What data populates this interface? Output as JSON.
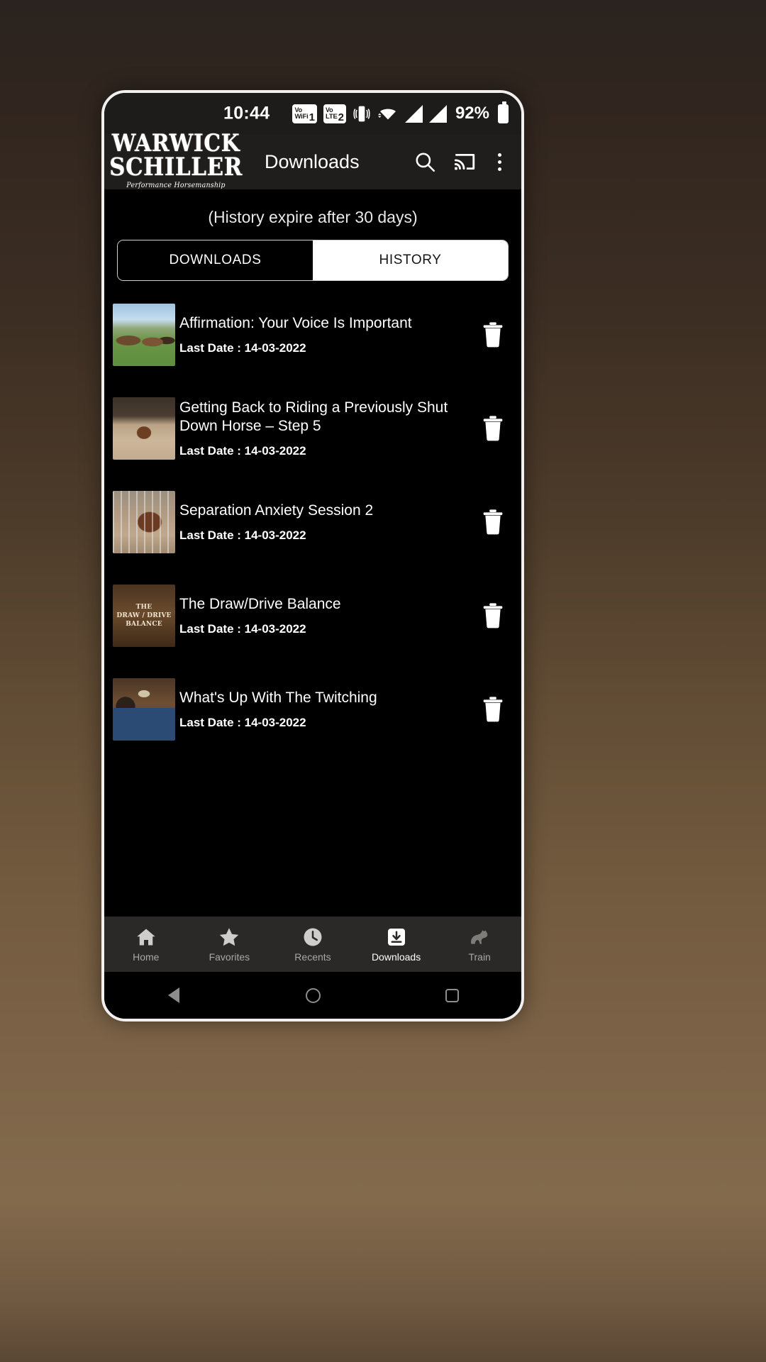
{
  "status_bar": {
    "time": "10:44",
    "battery_percent": "92%",
    "icons": [
      "vowifi-1-icon",
      "volte-2-icon",
      "vibrate-icon",
      "wifi-icon",
      "signal-bars-icon",
      "signal-bars-2-icon",
      "battery-icon"
    ],
    "vowifi": {
      "top": "Vo",
      "bottom": "WiFi",
      "sim": "1"
    },
    "volte": {
      "top": "Vo",
      "bottom": "LTE",
      "sim": "2"
    }
  },
  "header": {
    "logo_line1": "WARWICK",
    "logo_line2": "SCHILLER",
    "logo_tagline": "Performance Horsemanship",
    "title": "Downloads",
    "actions": [
      {
        "name": "search-icon",
        "label": "Search"
      },
      {
        "name": "cast-icon",
        "label": "Cast"
      },
      {
        "name": "overflow-menu-icon",
        "label": "More options"
      }
    ]
  },
  "main": {
    "history_notice": "(History expire after 30 days)",
    "tabs": [
      {
        "label": "DOWNLOADS",
        "active": false
      },
      {
        "label": "HISTORY",
        "active": true
      }
    ],
    "items": [
      {
        "title": "Affirmation: Your Voice Is Important",
        "date_label": "Last Date : 14-03-2022",
        "thumb": "t-horses",
        "thumb_text": ""
      },
      {
        "title": "Getting Back to Riding a Previously Shut Down Horse – Step 5",
        "date_label": "Last Date : 14-03-2022",
        "thumb": "t-arena",
        "thumb_text": ""
      },
      {
        "title": "Separation Anxiety Session 2",
        "date_label": "Last Date : 14-03-2022",
        "thumb": "t-fence",
        "thumb_text": ""
      },
      {
        "title": "The Draw/Drive Balance",
        "date_label": "Last Date : 14-03-2022",
        "thumb": "t-drawdrive",
        "thumb_text": "THE\nDRAW / DRIVE\nBALANCE"
      },
      {
        "title": "What's Up With The Twitching",
        "date_label": "Last Date : 14-03-2022",
        "thumb": "t-man",
        "thumb_text": ""
      }
    ],
    "delete_button_label": "Delete"
  },
  "bottom_nav": [
    {
      "label": "Home",
      "icon": "home-icon",
      "active": false
    },
    {
      "label": "Favorites",
      "icon": "star-icon",
      "active": false
    },
    {
      "label": "Recents",
      "icon": "clock-icon",
      "active": false
    },
    {
      "label": "Downloads",
      "icon": "download-icon",
      "active": true
    },
    {
      "label": "Train",
      "icon": "horse-icon",
      "active": false
    }
  ],
  "system_nav": [
    {
      "name": "back-button",
      "label": "Back"
    },
    {
      "name": "home-button",
      "label": "Home"
    },
    {
      "name": "recents-button",
      "label": "Recents"
    }
  ],
  "colors": {
    "screen_bg": "#000000",
    "header_bg": "#201e1c",
    "status_bg": "#1e1c1a",
    "bottom_nav_bg": "#2b2927",
    "active_tab_bg": "#ffffff",
    "text": "#ffffff",
    "inactive_nav_text": "#a9a7a4"
  }
}
